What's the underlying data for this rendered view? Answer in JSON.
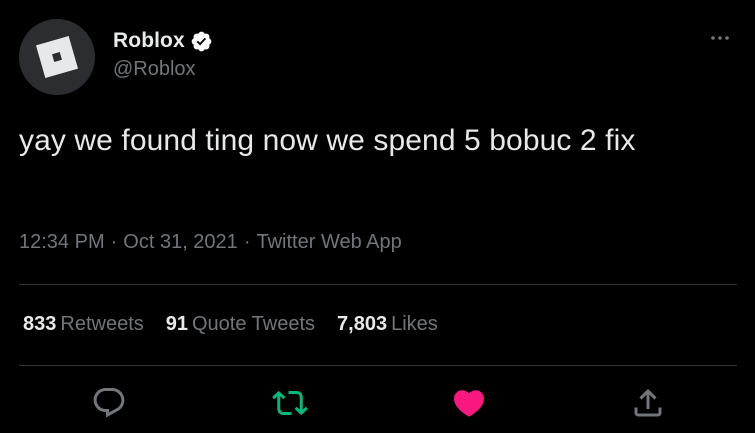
{
  "author": {
    "name": "Roblox",
    "handle": "@Roblox",
    "verified": true,
    "avatar_icon": "roblox-logo"
  },
  "tweet": {
    "text": "yay we found ting now we spend 5 bobuc 2 fix",
    "time": "12:34 PM",
    "date": "Oct 31, 2021",
    "source": "Twitter Web App",
    "separator": "·"
  },
  "stats": {
    "retweets_count": "833",
    "retweets_label": "Retweets",
    "quote_tweets_count": "91",
    "quote_tweets_label": "Quote Tweets",
    "likes_count": "7,803",
    "likes_label": "Likes"
  },
  "actions": {
    "reply_icon": "reply-icon",
    "retweet_icon": "retweet-icon",
    "like_icon": "heart-icon",
    "share_icon": "share-icon",
    "liked": true,
    "retweeted": false
  },
  "colors": {
    "background": "#000000",
    "text_primary": "#e7e9ea",
    "text_secondary": "#71767b",
    "divider": "#2f3336",
    "like_active": "#f91880",
    "retweet_color": "#00ba7c",
    "verified_badge": "#ffffff"
  }
}
